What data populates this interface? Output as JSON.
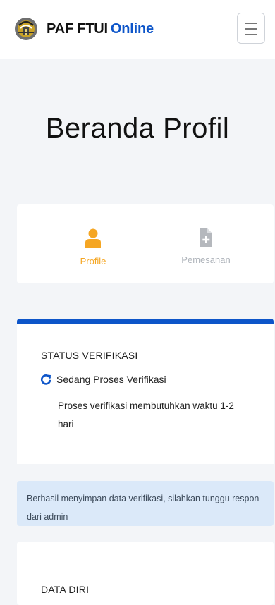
{
  "header": {
    "brand": "PAF FTUI",
    "brand_accent": "Online",
    "logo_icon": "university-emblem-icon",
    "menu_icon": "hamburger-menu-icon"
  },
  "page_title": "Beranda Profil",
  "tabs": [
    {
      "label": "Profile",
      "icon": "person-icon",
      "active": true,
      "color": "#f5a623"
    },
    {
      "label": "Pemesanan",
      "icon": "document-add-icon",
      "active": false,
      "color": "#aeb3ba"
    }
  ],
  "status": {
    "heading": "STATUS VERIFIKASI",
    "state": "Sedang Proses Verifikasi",
    "note": "Proses verifikasi membutuhkan waktu 1-2 hari",
    "accent": "#0d55c9",
    "icon": "refresh-icon"
  },
  "alert": {
    "message": "Berhasil menyimpan data verifikasi, silahkan tunggu respon dari admin"
  },
  "data_diri": {
    "heading": "DATA DIRI"
  }
}
